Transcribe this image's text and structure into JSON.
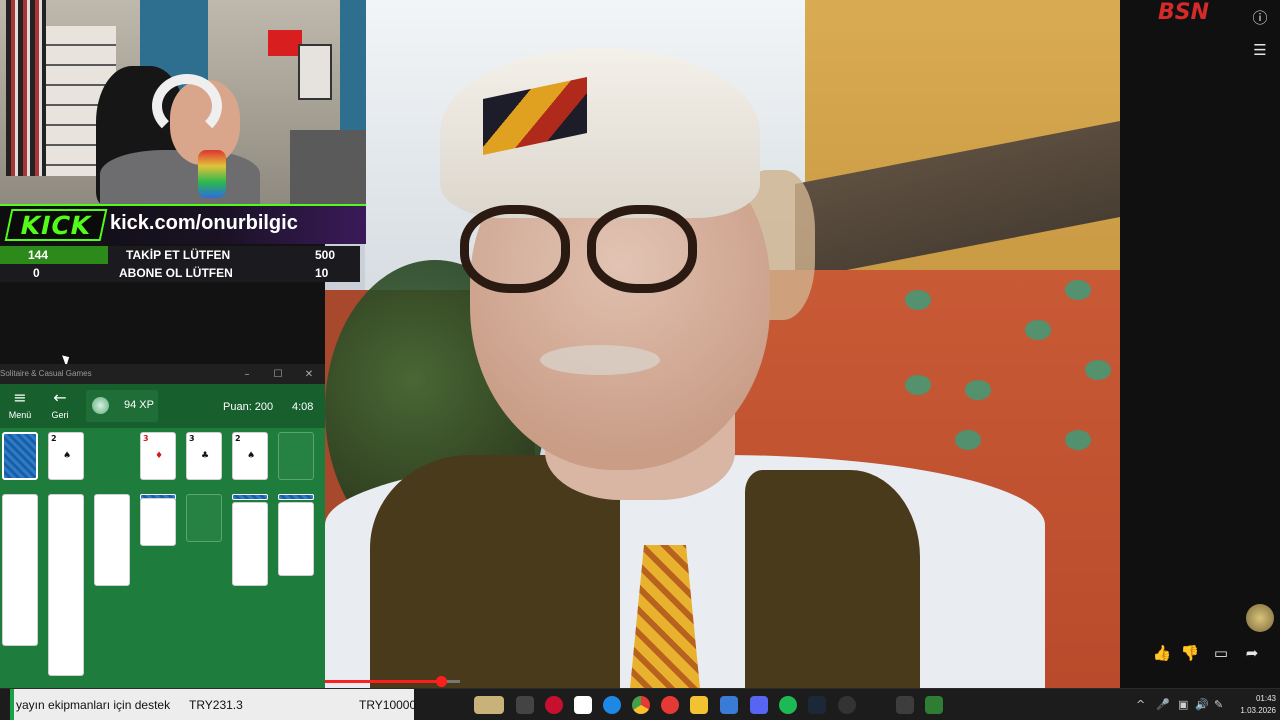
{
  "stream": {
    "kick_logo": "KICK",
    "url": "kick.com/onurbilgic",
    "goals": [
      {
        "current": "144",
        "label": "TAKİP ET LÜTFEN",
        "target": "500"
      },
      {
        "current": "0",
        "label": "ABONE OL LÜTFEN",
        "target": "10"
      }
    ],
    "brand_logo": "BSN"
  },
  "video": {
    "progress_fraction": 0.86,
    "colors": {
      "progress": "#ff1e1e",
      "kick_green": "#53fc18"
    }
  },
  "right_panel": {
    "icons": [
      "info-icon",
      "playlist-icon",
      "like-icon",
      "dislike-icon",
      "comment-icon",
      "share-icon"
    ],
    "glyphs": {
      "info": "ⓘ",
      "playlist": "☰",
      "like": "👍",
      "dislike": "👎",
      "comment": "▭",
      "share": "➦"
    }
  },
  "solitaire": {
    "window_title": "Solitaire & Casual Games",
    "menu_label": "Menü",
    "back_label": "Geri",
    "xp": "94 XP",
    "score": "Puan: 200",
    "time": "4:08",
    "glyphs": {
      "menu": "≡",
      "back": "←",
      "minimize": "–",
      "maximize": "☐",
      "close": "✕"
    },
    "top_row": [
      {
        "rank": "2",
        "suit": "♠",
        "color": "black"
      },
      {
        "rank": "3",
        "suit": "♦",
        "color": "red"
      },
      {
        "rank": "3",
        "suit": "♣",
        "color": "black"
      },
      {
        "rank": "2",
        "suit": "♠",
        "color": "black"
      }
    ],
    "stock_back": "card-back"
  },
  "taskbar": {
    "donation_text": "yayın ekipmanları için destek",
    "donation_current": "TRY231.3",
    "donation_goal": "TRY10000",
    "time": "01:43",
    "date": "1.03.2026",
    "tray_glyphs": {
      "chevron": "^",
      "mic": "🎤",
      "display": "▣",
      "volume": "🔊",
      "pen": "✎"
    }
  }
}
